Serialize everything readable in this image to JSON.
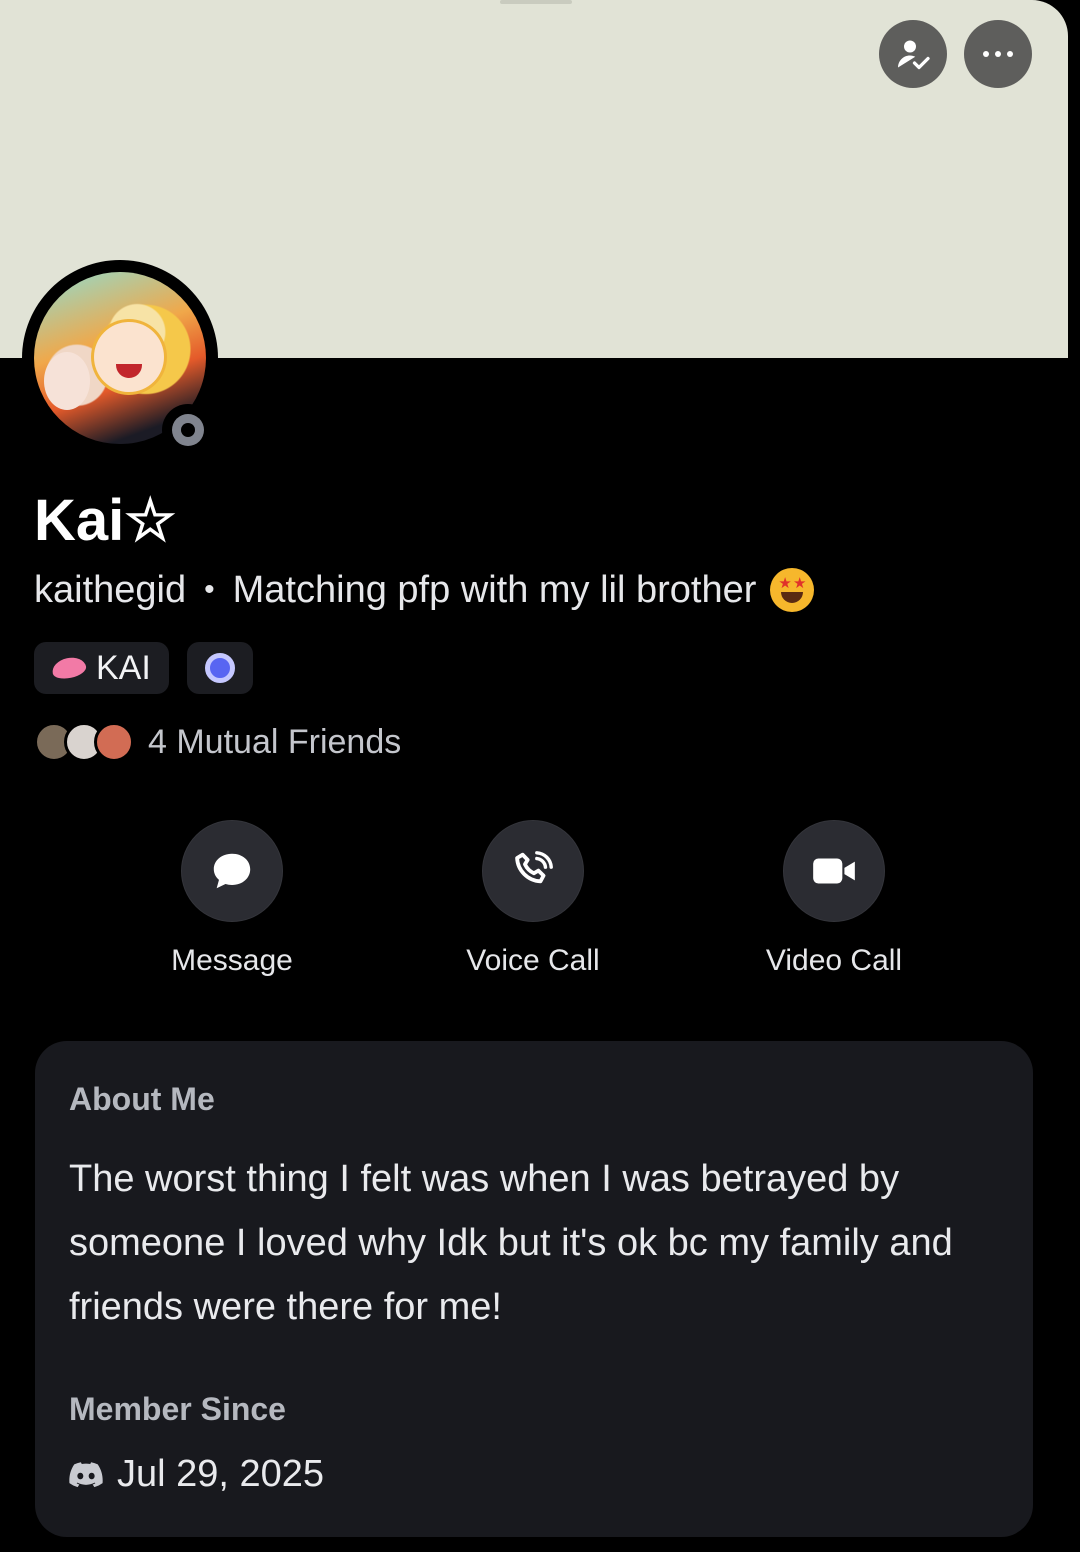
{
  "profile": {
    "display_name": "Kai☆",
    "username": "kaithegid",
    "separator": "•",
    "status": "Matching pfp with my lil brother",
    "status_emoji": "star-struck-emoji",
    "presence": "offline"
  },
  "header": {
    "friend_button_icon": "person-check-icon",
    "more_button_icon": "more-dots-icon"
  },
  "badges": [
    {
      "icon": "lips-icon",
      "label": "KAI"
    },
    {
      "icon": "nitro-badge-icon",
      "label": ""
    }
  ],
  "mutual_friends": {
    "label": "4 Mutual Friends"
  },
  "actions": {
    "message": "Message",
    "voice_call": "Voice Call",
    "video_call": "Video Call"
  },
  "about": {
    "heading": "About Me",
    "text": "The worst thing I felt was when I was betrayed by someone I loved why Idk but it's ok bc my family and friends were there for me!"
  },
  "member_since": {
    "heading": "Member Since",
    "date": "Jul 29, 2025",
    "icon": "discord-logo-icon"
  },
  "colors": {
    "banner": "#e1e3d6",
    "background": "#000000",
    "card": "#18191e",
    "button": "#2b2c32"
  }
}
